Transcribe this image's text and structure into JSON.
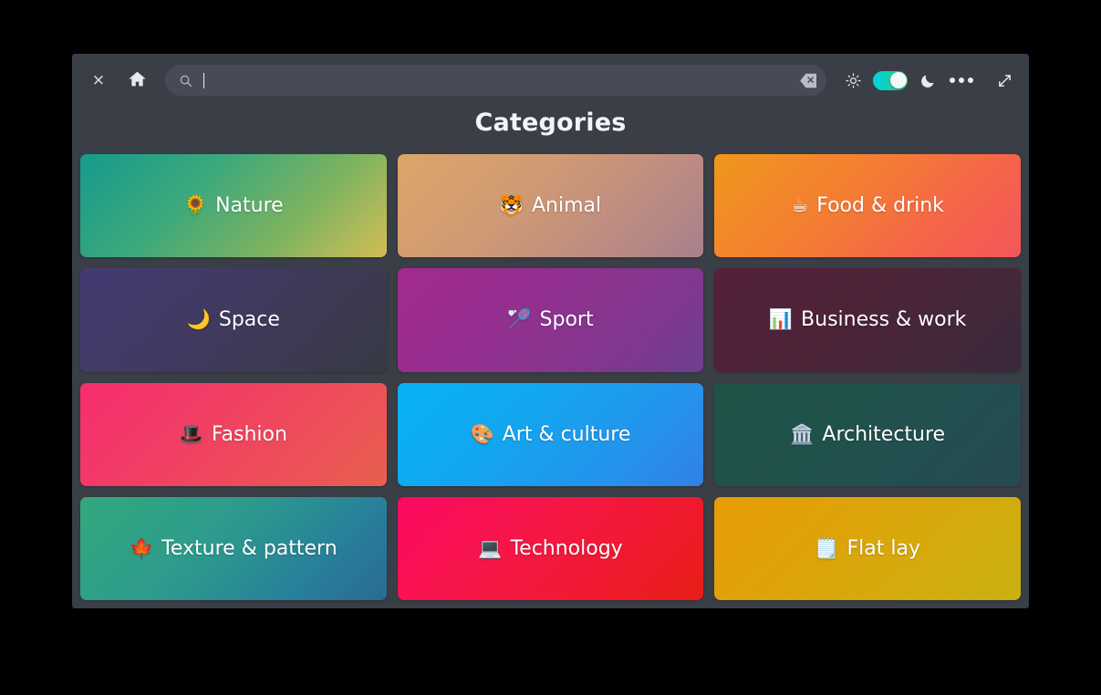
{
  "window": {
    "background": "#3a3e47",
    "page_background": "#000000"
  },
  "toolbar": {
    "close_label": "×",
    "close_name": "close-icon",
    "home_name": "home-icon",
    "search": {
      "value": "",
      "placeholder": "",
      "icon": "search-icon",
      "clear_icon": "backspace-clear-icon"
    },
    "brightness_icon": "sun-icon",
    "theme_toggle": {
      "state": "on",
      "gradient_from": "#00d3e6",
      "gradient_to": "#2ecc71",
      "knob_color": "#f5f6f8"
    },
    "dark_icon": "moon-icon",
    "more_icon": "three-dots-menu-icon",
    "expand_icon": "expand-fullscreen-icon"
  },
  "header": {
    "title": "Categories"
  },
  "categories": [
    {
      "label": "Nature",
      "emoji": "🌻",
      "emoji_name": "sunflower-emoji",
      "gradient": "linear-gradient(135deg, #169b8c 0%, #3aa87d 35%, #7fb35f 70%, #d3bd54 100%)"
    },
    {
      "label": "Animal",
      "emoji": "🐯",
      "emoji_name": "tiger-face-emoji",
      "gradient": "linear-gradient(135deg, #dda56a 0%, #cf9a74 40%, #bb8b83 75%, #a8808c 100%)"
    },
    {
      "label": "Food & drink",
      "emoji": "☕",
      "emoji_name": "hot-beverage-emoji",
      "gradient": "linear-gradient(135deg, #f0971b 0%, #f47b35 45%, #f5634b 75%, #f4565c 100%)"
    },
    {
      "label": "Space",
      "emoji": "🌙",
      "emoji_name": "crescent-moon-emoji",
      "gradient": "linear-gradient(135deg, #443a72 0%, #413a63 40%, #3c3a50 75%, #373a44 100%)"
    },
    {
      "label": "Sport",
      "emoji": "🏸",
      "emoji_name": "badminton-emoji",
      "gradient": "linear-gradient(135deg, #a32a8f 0%, #93308f 40%, #80388e 75%, #6e3f8e 100%)"
    },
    {
      "label": "Business & work",
      "emoji": "📊",
      "emoji_name": "bar-chart-emoji",
      "gradient": "linear-gradient(135deg, #55203b 0%, #4d2338 40%, #43273a 75%, #39293c 100%)"
    },
    {
      "label": "Fashion",
      "emoji": "🎩",
      "emoji_name": "top-hat-emoji",
      "gradient": "linear-gradient(135deg, #f62d6e 0%, #f13f63 40%, #ec5257 75%, #e75f4f 100%)"
    },
    {
      "label": "Art & culture",
      "emoji": "🎨",
      "emoji_name": "artist-palette-emoji",
      "gradient": "linear-gradient(135deg, #06b4f2 0%, #14a5ef 40%, #2592eb 75%, #3081e6 100%)"
    },
    {
      "label": "Architecture",
      "emoji": "🏛️",
      "emoji_name": "classical-building-emoji",
      "gradient": "linear-gradient(135deg, #1d5346 0%, #20524c 40%, #234e50 75%, #264a52 100%)"
    },
    {
      "label": "Texture & pattern",
      "emoji": "🍁",
      "emoji_name": "maple-leaf-emoji",
      "gradient": "linear-gradient(135deg, #33a87d 0%, #2d9c8c 40%, #28809a 75%, #2a6a93 100%)"
    },
    {
      "label": "Technology",
      "emoji": "💻",
      "emoji_name": "laptop-emoji",
      "gradient": "linear-gradient(135deg, #fb0a63 0%, #f61647 40%, #ef1a2c 75%, #e71e16 100%)"
    },
    {
      "label": "Flat lay",
      "emoji": "🗒️",
      "emoji_name": "tabbed-notebook-emoji",
      "gradient": "linear-gradient(135deg, #e79c06 0%, #dda40a 40%, #d2ac0d 75%, #c8b211 100%)"
    }
  ]
}
